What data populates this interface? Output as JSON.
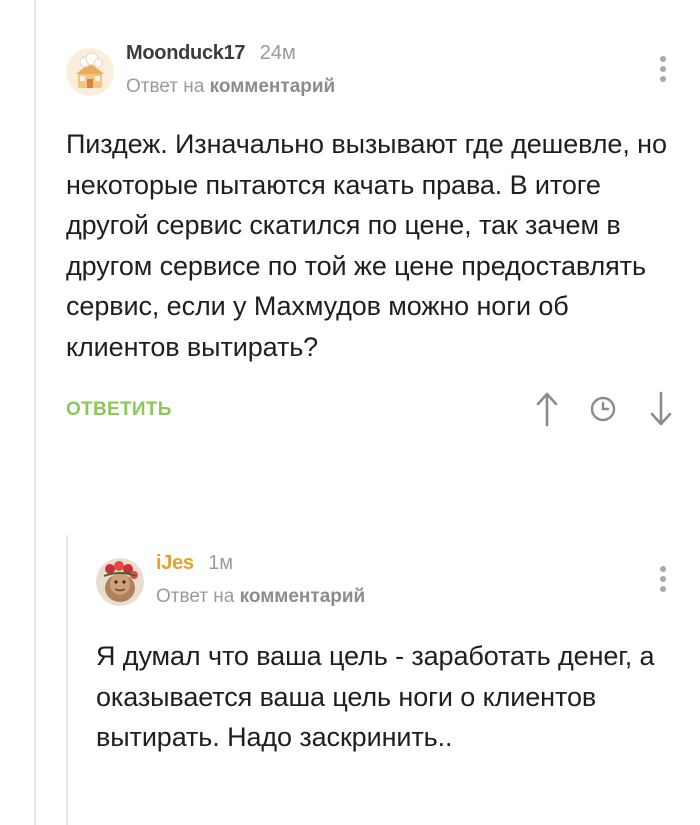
{
  "comments": [
    {
      "author": "Moonduck17",
      "time": "24м",
      "reply_prefix": "Ответ на",
      "reply_target": "комментарий",
      "text": "Пиздеж. Изначально вызывают где дешевле, но некоторые пытаются качать права. В итоге другой сервис скатился по цене, так зачем в другом сервисе по той же цене предоставлять сервис, если у Махмудов можно ноги об клиентов вытирать?",
      "reply_label": "ОТВЕТИТЬ"
    },
    {
      "author": "iJes",
      "time": "1м",
      "reply_prefix": "Ответ на",
      "reply_target": "комментарий",
      "text": "Я думал что ваша цель - заработать денег, а оказывается ваша цель ноги о клиентов вытирать. Надо заскринить.."
    }
  ],
  "colors": {
    "accent_green": "#8ac858",
    "author_orange": "#e8a02d",
    "muted_gray": "#9a9a9a"
  },
  "icons": {
    "menu": "more-vertical-icon",
    "upvote": "arrow-up-icon",
    "history": "clock-icon",
    "downvote": "arrow-down-icon"
  }
}
